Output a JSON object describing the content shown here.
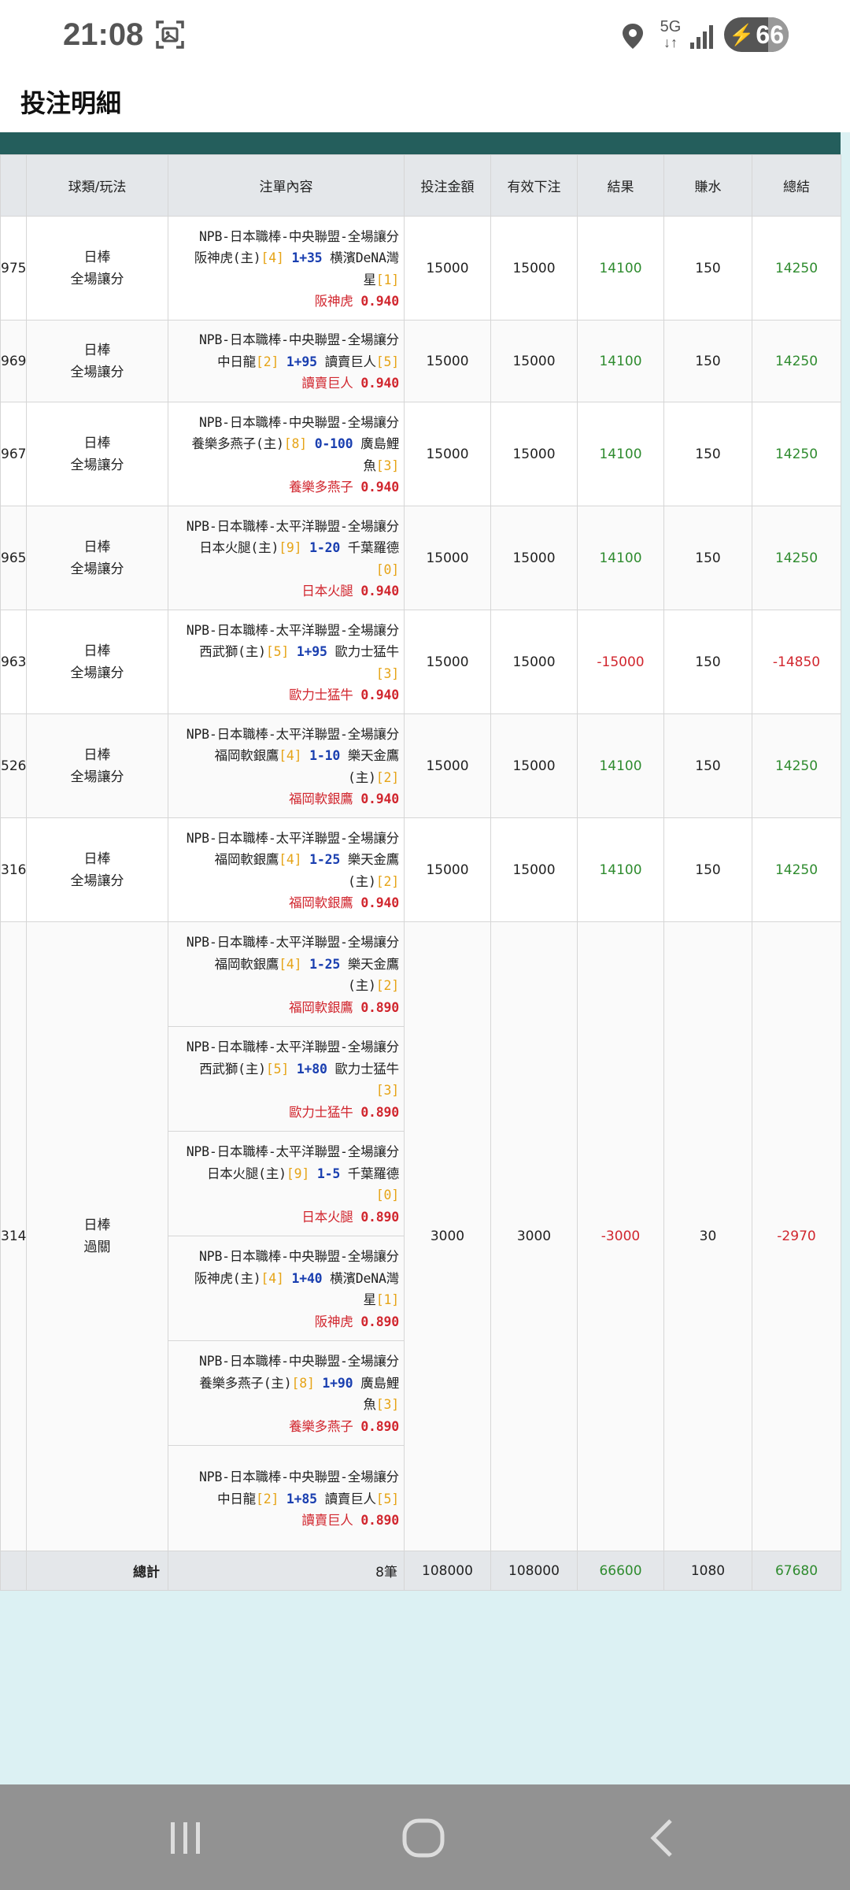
{
  "status": {
    "time": "21:08",
    "network": "5G",
    "battery": "66"
  },
  "page": {
    "title": "投注明細"
  },
  "columns": [
    "球類/玩法",
    "注單內容",
    "投注金額",
    "有效下注",
    "結果",
    "賺水",
    "總結"
  ],
  "rows": [
    {
      "id": "975",
      "sport": "日棒",
      "play": "全場讓分",
      "league": "NPB-日本職棒-中央聯盟-全場讓分",
      "team1": "阪神虎(主)",
      "hc1": "[4]",
      "line": "1+35",
      "team2": "横濱DeNA灣",
      "team2b": "星",
      "hc2": "[1]",
      "pick": "阪神虎",
      "odds": "0.940",
      "stake": "15000",
      "valid": "15000",
      "result": "14100",
      "rebate": "150",
      "total": "14250",
      "win": true
    },
    {
      "id": "969",
      "sport": "日棒",
      "play": "全場讓分",
      "league": "NPB-日本職棒-中央聯盟-全場讓分",
      "team1": "中日龍",
      "hc1": "[2]",
      "line": "1+95",
      "team2": "讀賣巨人",
      "team2b": "",
      "hc2": "[5]",
      "pick": "讀賣巨人",
      "odds": "0.940",
      "stake": "15000",
      "valid": "15000",
      "result": "14100",
      "rebate": "150",
      "total": "14250",
      "win": true
    },
    {
      "id": "967",
      "sport": "日棒",
      "play": "全場讓分",
      "league": "NPB-日本職棒-中央聯盟-全場讓分",
      "team1": "養樂多燕子(主)",
      "hc1": "[8]",
      "line": "0-100",
      "team2": "廣島鯉",
      "team2b": "魚",
      "hc2": "[3]",
      "pick": "養樂多燕子",
      "odds": "0.940",
      "stake": "15000",
      "valid": "15000",
      "result": "14100",
      "rebate": "150",
      "total": "14250",
      "win": true
    },
    {
      "id": "965",
      "sport": "日棒",
      "play": "全場讓分",
      "league": "NPB-日本職棒-太平洋聯盟-全場讓分",
      "team1": "日本火腿(主)",
      "hc1": "[9]",
      "line": "1-20",
      "team2": "千葉羅德",
      "team2b": "",
      "hc2": "[0]",
      "pick": "日本火腿",
      "odds": "0.940",
      "stake": "15000",
      "valid": "15000",
      "result": "14100",
      "rebate": "150",
      "total": "14250",
      "win": true
    },
    {
      "id": "963",
      "sport": "日棒",
      "play": "全場讓分",
      "league": "NPB-日本職棒-太平洋聯盟-全場讓分",
      "team1": "西武獅(主)",
      "hc1": "[5]",
      "line": "1+95",
      "team2": "歐力士猛牛",
      "team2b": "",
      "hc2": "[3]",
      "pick": "歐力士猛牛",
      "odds": "0.940",
      "stake": "15000",
      "valid": "15000",
      "result": "-15000",
      "rebate": "150",
      "total": "-14850",
      "win": false
    },
    {
      "id": "526",
      "sport": "日棒",
      "play": "全場讓分",
      "league": "NPB-日本職棒-太平洋聯盟-全場讓分",
      "team1": "福岡軟銀鷹",
      "hc1": "[4]",
      "line": "1-10",
      "team2": "樂天金鷹",
      "team2b": "(主)",
      "hc2": "[2]",
      "pick": "福岡軟銀鷹",
      "odds": "0.940",
      "stake": "15000",
      "valid": "15000",
      "result": "14100",
      "rebate": "150",
      "total": "14250",
      "win": true
    },
    {
      "id": "316",
      "sport": "日棒",
      "play": "全場讓分",
      "league": "NPB-日本職棒-太平洋聯盟-全場讓分",
      "team1": "福岡軟銀鷹",
      "hc1": "[4]",
      "line": "1-25",
      "team2": "樂天金鷹",
      "team2b": "(主)",
      "hc2": "[2]",
      "pick": "福岡軟銀鷹",
      "odds": "0.940",
      "stake": "15000",
      "valid": "15000",
      "result": "14100",
      "rebate": "150",
      "total": "14250",
      "win": true
    }
  ],
  "parlay": {
    "id": "314",
    "sport": "日棒",
    "play": "過關",
    "stake": "3000",
    "valid": "3000",
    "result": "-3000",
    "rebate": "30",
    "total": "-2970",
    "legs": [
      {
        "league": "NPB-日本職棒-太平洋聯盟-全場讓分",
        "team1": "福岡軟銀鷹",
        "hc1": "[4]",
        "line": "1-25",
        "team2": "樂天金鷹",
        "team2b": "(主)",
        "hc2": "[2]",
        "pick": "福岡軟銀鷹",
        "odds": "0.890"
      },
      {
        "league": "NPB-日本職棒-太平洋聯盟-全場讓分",
        "team1": "西武獅(主)",
        "hc1": "[5]",
        "line": "1+80",
        "team2": "歐力士猛牛",
        "team2b": "",
        "hc2": "[3]",
        "pick": "歐力士猛牛",
        "odds": "0.890"
      },
      {
        "league": "NPB-日本職棒-太平洋聯盟-全場讓分",
        "team1": "日本火腿(主)",
        "hc1": "[9]",
        "line": "1-5",
        "team2": "千葉羅德",
        "team2b": "",
        "hc2": "[0]",
        "pick": "日本火腿",
        "odds": "0.890"
      },
      {
        "league": "NPB-日本職棒-中央聯盟-全場讓分",
        "team1": "阪神虎(主)",
        "hc1": "[4]",
        "line": "1+40",
        "team2": "横濱DeNA灣",
        "team2b": "星",
        "hc2": "[1]",
        "pick": "阪神虎",
        "odds": "0.890"
      },
      {
        "league": "NPB-日本職棒-中央聯盟-全場讓分",
        "team1": "養樂多燕子(主)",
        "hc1": "[8]",
        "line": "1+90",
        "team2": "廣島鯉",
        "team2b": "魚",
        "hc2": "[3]",
        "pick": "養樂多燕子",
        "odds": "0.890"
      },
      {
        "league": "NPB-日本職棒-中央聯盟-全場讓分",
        "team1": "中日龍",
        "hc1": "[2]",
        "line": "1+85",
        "team2": "讀賣巨人",
        "team2b": "",
        "hc2": "[5]",
        "pick": "讀賣巨人",
        "odds": "0.890"
      }
    ]
  },
  "totals": {
    "label": "總計",
    "count": "8筆",
    "stake": "108000",
    "valid": "108000",
    "result": "66600",
    "rebate": "1080",
    "total": "67680"
  },
  "colors": {
    "header_band": "#245e5c",
    "win": "#2e8b2e",
    "loss": "#d1262e",
    "handicap": "#e6a417",
    "line": "#1a3fb0"
  },
  "icons": {
    "nav_recents": "recents-icon",
    "nav_home": "home-icon",
    "nav_back": "back-icon"
  }
}
